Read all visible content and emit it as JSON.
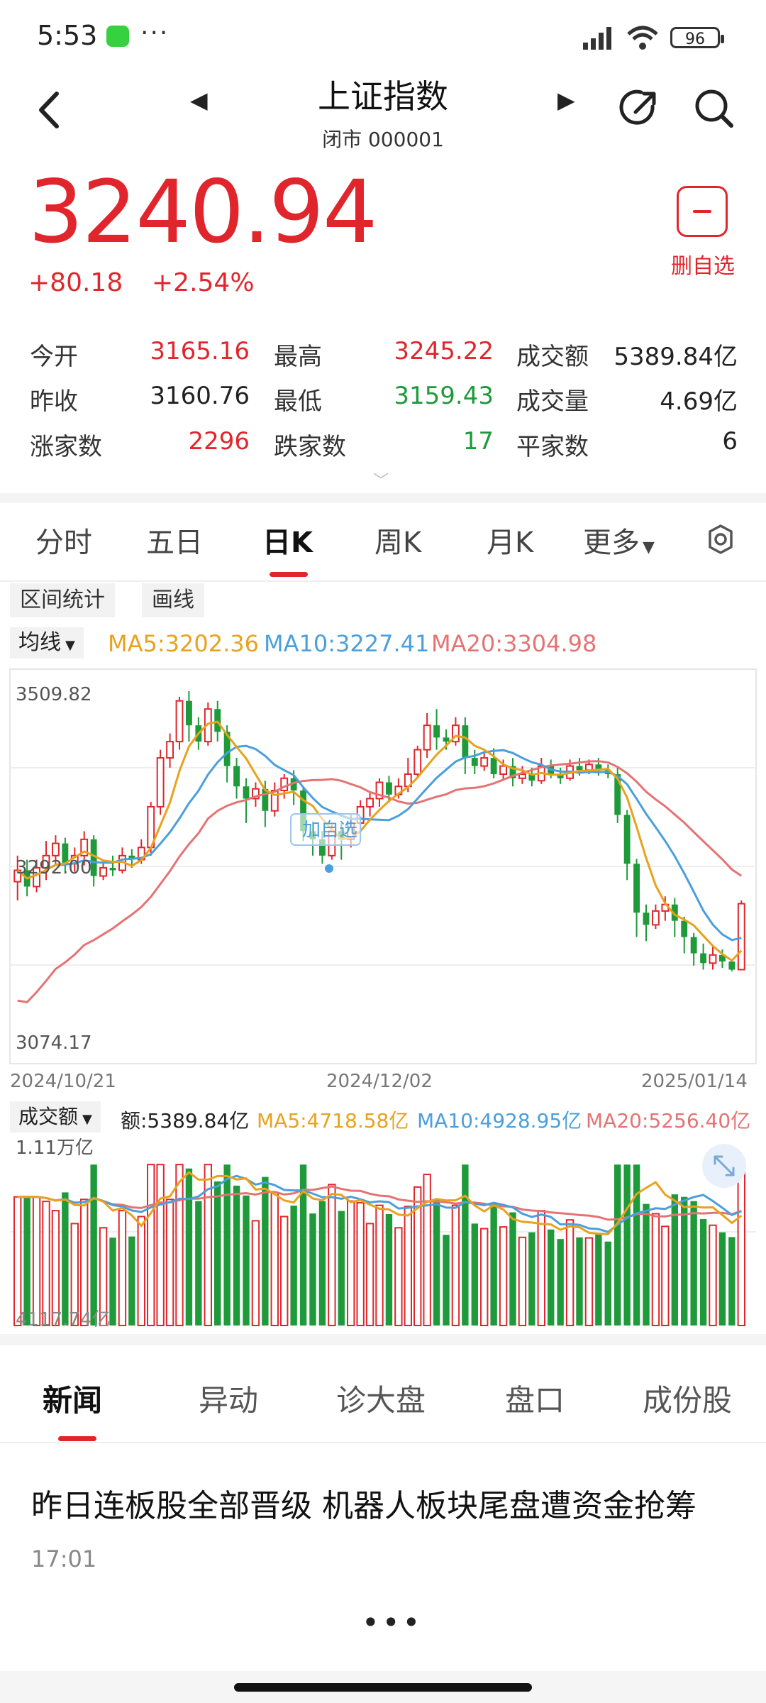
{
  "status": {
    "time": "5:53",
    "battery": "96"
  },
  "header": {
    "title": "上证指数",
    "subtitle": "闭市 000001"
  },
  "quote": {
    "price": "3240.94",
    "change": "+80.18",
    "change_pct": "+2.54%",
    "watch_label": "删自选"
  },
  "stats": [
    {
      "label": "今开",
      "value": "3165.16",
      "color": "#e0262c"
    },
    {
      "label": "最高",
      "value": "3245.22",
      "color": "#e0262c"
    },
    {
      "label": "成交额",
      "value": "5389.84亿",
      "color": "#222222"
    },
    {
      "label": "昨收",
      "value": "3160.76",
      "color": "#222222"
    },
    {
      "label": "最低",
      "value": "3159.43",
      "color": "#1f9a3a"
    },
    {
      "label": "成交量",
      "value": "4.69亿",
      "color": "#222222"
    },
    {
      "label": "涨家数",
      "value": "2296",
      "color": "#e0262c"
    },
    {
      "label": "跌家数",
      "value": "17",
      "color": "#1f9a3a"
    },
    {
      "label": "平家数",
      "value": "6",
      "color": "#222222"
    }
  ],
  "period_tabs": [
    "分时",
    "五日",
    "日K",
    "周K",
    "月K",
    "更多"
  ],
  "tools": [
    "区间统计",
    "画线"
  ],
  "ma": {
    "select": "均线",
    "ma5": "MA5:3202.36",
    "ma10": "MA10:3227.41",
    "ma20": "MA20:3304.98",
    "colors": {
      "ma5": "#e8a21d",
      "ma10": "#4a9fdc",
      "ma20": "#e57373"
    }
  },
  "chart_data": [
    {
      "type": "candlestick",
      "y_max_label": "3509.82",
      "y_min_label": "3074.17",
      "mid_label": "3292.00",
      "x_labels": [
        "2024/10/21",
        "2024/12/02",
        "2025/01/14"
      ],
      "ylim": [
        3074.17,
        3509.82
      ],
      "annotation": "加自选",
      "candles": [
        [
          3268,
          3282,
          3245,
          3300
        ],
        [
          3282,
          3262,
          3250,
          3295
        ],
        [
          3262,
          3285,
          3255,
          3295
        ],
        [
          3285,
          3300,
          3270,
          3318
        ],
        [
          3300,
          3315,
          3288,
          3325
        ],
        [
          3315,
          3290,
          3280,
          3322
        ],
        [
          3290,
          3300,
          3280,
          3310
        ],
        [
          3300,
          3320,
          3288,
          3330
        ],
        [
          3320,
          3275,
          3262,
          3325
        ],
        [
          3275,
          3285,
          3270,
          3295
        ],
        [
          3285,
          3282,
          3275,
          3300
        ],
        [
          3282,
          3300,
          3278,
          3310
        ],
        [
          3300,
          3295,
          3285,
          3308
        ],
        [
          3295,
          3310,
          3290,
          3320
        ],
        [
          3310,
          3360,
          3300,
          3366
        ],
        [
          3360,
          3420,
          3350,
          3430
        ],
        [
          3420,
          3440,
          3408,
          3450
        ],
        [
          3440,
          3490,
          3430,
          3495
        ],
        [
          3490,
          3460,
          3440,
          3502
        ],
        [
          3460,
          3440,
          3430,
          3470
        ],
        [
          3440,
          3480,
          3435,
          3488
        ],
        [
          3480,
          3452,
          3440,
          3490
        ],
        [
          3452,
          3410,
          3390,
          3460
        ],
        [
          3410,
          3385,
          3370,
          3420
        ],
        [
          3385,
          3370,
          3340,
          3395
        ],
        [
          3370,
          3382,
          3360,
          3390
        ],
        [
          3382,
          3355,
          3335,
          3392
        ],
        [
          3355,
          3380,
          3348,
          3390
        ],
        [
          3380,
          3395,
          3370,
          3400
        ],
        [
          3395,
          3380,
          3362,
          3405
        ],
        [
          3380,
          3330,
          3318,
          3385
        ],
        [
          3330,
          3320,
          3300,
          3342
        ],
        [
          3320,
          3300,
          3290,
          3330
        ],
        [
          3300,
          3330,
          3295,
          3338
        ],
        [
          3330,
          3320,
          3295,
          3340
        ],
        [
          3320,
          3340,
          3310,
          3350
        ],
        [
          3340,
          3360,
          3330,
          3368
        ],
        [
          3360,
          3370,
          3348,
          3378
        ],
        [
          3370,
          3390,
          3360,
          3395
        ],
        [
          3390,
          3375,
          3365,
          3398
        ],
        [
          3375,
          3385,
          3370,
          3395
        ],
        [
          3385,
          3400,
          3378,
          3420
        ],
        [
          3400,
          3430,
          3395,
          3435
        ],
        [
          3430,
          3460,
          3420,
          3475
        ],
        [
          3460,
          3445,
          3430,
          3480
        ],
        [
          3445,
          3440,
          3430,
          3455
        ],
        [
          3440,
          3460,
          3435,
          3470
        ],
        [
          3460,
          3420,
          3400,
          3470
        ],
        [
          3420,
          3410,
          3400,
          3430
        ],
        [
          3410,
          3420,
          3404,
          3428
        ],
        [
          3420,
          3400,
          3395,
          3432
        ],
        [
          3400,
          3410,
          3392,
          3418
        ],
        [
          3410,
          3395,
          3385,
          3420
        ],
        [
          3395,
          3400,
          3388,
          3410
        ],
        [
          3400,
          3392,
          3385,
          3408
        ],
        [
          3392,
          3410,
          3388,
          3420
        ],
        [
          3410,
          3400,
          3395,
          3418
        ],
        [
          3400,
          3395,
          3388,
          3408
        ],
        [
          3395,
          3410,
          3392,
          3418
        ],
        [
          3410,
          3405,
          3398,
          3420
        ],
        [
          3405,
          3412,
          3400,
          3418
        ],
        [
          3412,
          3405,
          3398,
          3420
        ],
        [
          3405,
          3400,
          3395,
          3412
        ],
        [
          3400,
          3350,
          3340,
          3408
        ],
        [
          3350,
          3290,
          3270,
          3356
        ],
        [
          3290,
          3230,
          3200,
          3296
        ],
        [
          3230,
          3215,
          3195,
          3240
        ],
        [
          3215,
          3232,
          3210,
          3240
        ],
        [
          3232,
          3240,
          3220,
          3250
        ],
        [
          3240,
          3220,
          3200,
          3248
        ],
        [
          3220,
          3200,
          3180,
          3225
        ],
        [
          3200,
          3180,
          3165,
          3205
        ],
        [
          3180,
          3168,
          3160,
          3192
        ],
        [
          3168,
          3178,
          3160,
          3188
        ],
        [
          3178,
          3170,
          3162,
          3185
        ],
        [
          3170,
          3160,
          3158,
          3172
        ],
        [
          3160,
          3241,
          3159,
          3245
        ]
      ]
    },
    {
      "type": "bar",
      "metric_label": "成交额",
      "amount": "额:5389.84亿",
      "ma5": "MA5:4718.58亿",
      "ma10": "MA10:4928.95亿",
      "ma20": "MA20:5256.40亿",
      "y_max_label": "1.11万亿",
      "y_min_label": "4117.74亿"
    }
  ],
  "news_tabs": [
    "新闻",
    "异动",
    "诊大盘",
    "盘口",
    "成份股"
  ],
  "news": [
    {
      "headline": "昨日连板股全部晋级 机器人板块尾盘遭资金抢筹",
      "time": "17:01"
    }
  ]
}
